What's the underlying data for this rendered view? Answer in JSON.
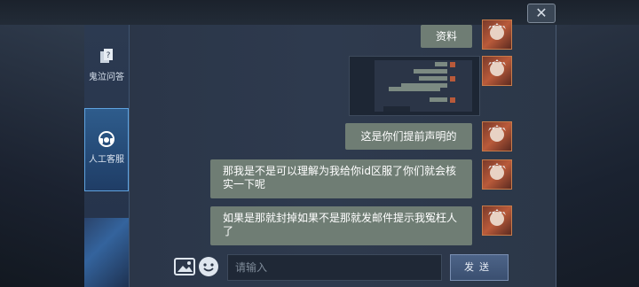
{
  "window": {
    "close_glyph": "✕",
    "close_icon": "close-icon"
  },
  "sidebar": {
    "items": [
      {
        "label": "鬼泣问答",
        "icon": "help-book-icon",
        "active": false
      },
      {
        "label": "人工客服",
        "icon": "headset-icon",
        "active": true
      }
    ]
  },
  "chat": {
    "messages": [
      {
        "text": "资料",
        "from": "user"
      },
      {
        "text": "",
        "from": "user",
        "type": "image"
      },
      {
        "text": "这是你们提前声明的",
        "from": "user"
      },
      {
        "text": "那我是不是可以理解为我给你id区服了你们就会核实一下呢",
        "from": "user"
      },
      {
        "text": "如果是那就封掉如果不是那就发邮件提示我冤枉人了",
        "from": "user"
      }
    ],
    "avatar_icon": "user-avatar-icon"
  },
  "composer": {
    "image_icon": "image-upload-icon",
    "emoji_icon": "emoji-icon",
    "input_placeholder": "请输入",
    "send_label": "发送"
  },
  "colors": {
    "bubble": "#6f7d74",
    "panel": "#2e3a4e",
    "active_tab": "#2e5c8c"
  }
}
